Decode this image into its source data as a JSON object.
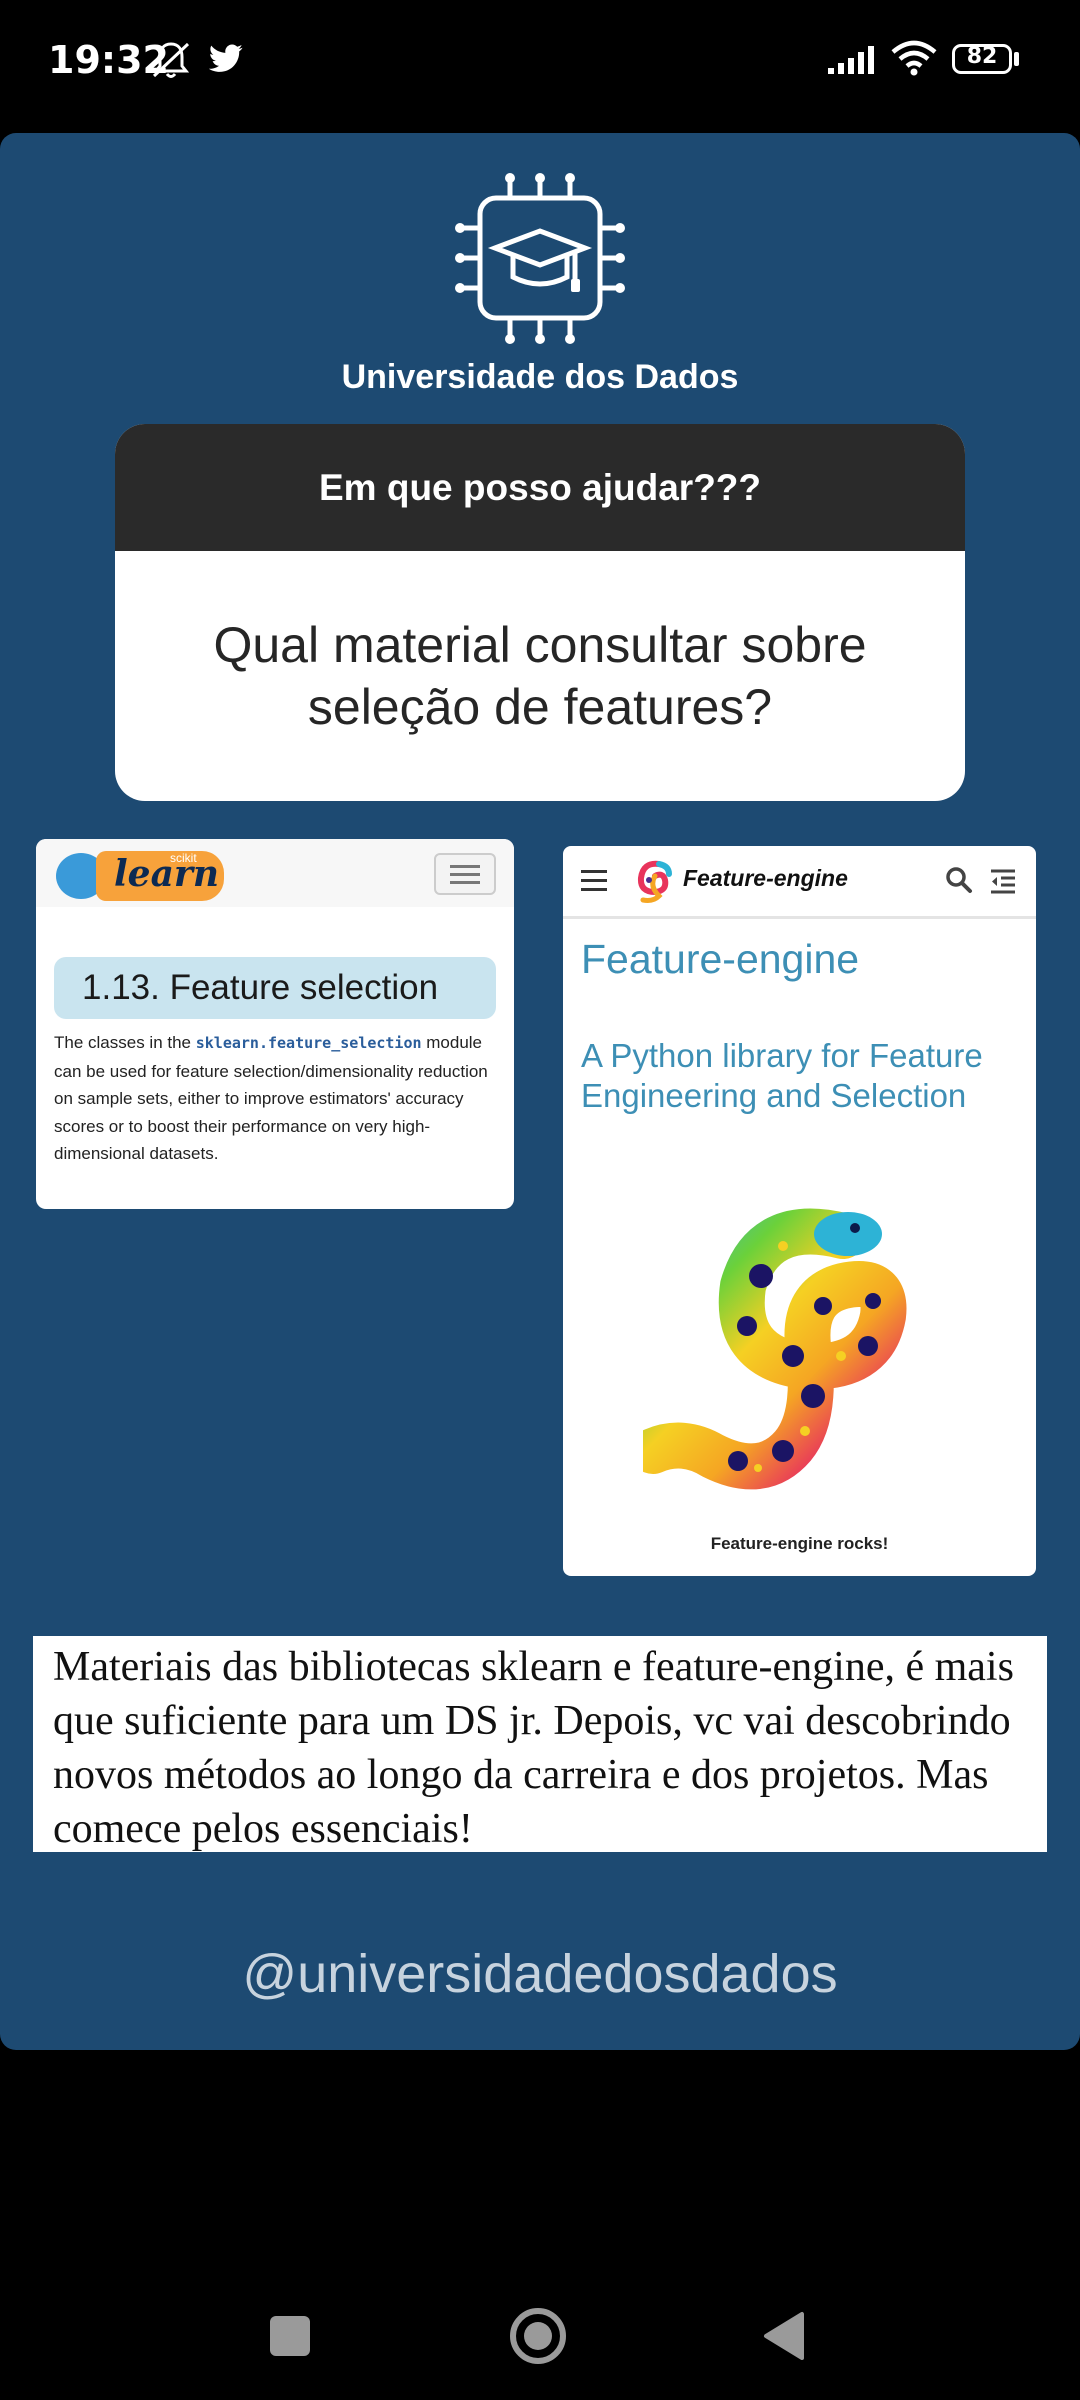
{
  "status_bar": {
    "time": "19:32",
    "battery": "82",
    "icons": [
      "do-not-disturb-icon",
      "twitter-icon",
      "signal-icon",
      "wifi-icon",
      "battery-icon"
    ]
  },
  "story": {
    "brand": "Universidade dos Dados",
    "question_header": "Em que posso ajudar???",
    "question_body": "Qual material consultar sobre seleção de features?",
    "sklearn": {
      "logo_small": "scikit",
      "logo_text": "learn",
      "section_title": "1.13. Feature selection",
      "text_before": "The classes in the ",
      "code": "sklearn.feature_selection",
      "text_after": " module can be used for feature selection/dimensionality reduction on sample sets, either to improve estimators' accuracy scores or to boost their performance on very high-dimensional datasets."
    },
    "feature_engine": {
      "app_name": "Feature-engine",
      "heading": "Feature-engine",
      "subtitle": "A Python library for Feature Engineering and Selection",
      "caption": "Feature-engine rocks!"
    },
    "caption_text": "Materiais das bibliotecas sklearn e feature-engine, é mais que suficiente para um DS jr. Depois, vc vai descobrindo novos métodos ao longo da carreira e dos projetos. Mas comece pelos essenciais!",
    "handle": "@universidadedosdados"
  },
  "colors": {
    "card_bg": "#1d4a72",
    "accent_blue": "#3d8fb5",
    "sklearn_orange": "#f7a23b"
  }
}
